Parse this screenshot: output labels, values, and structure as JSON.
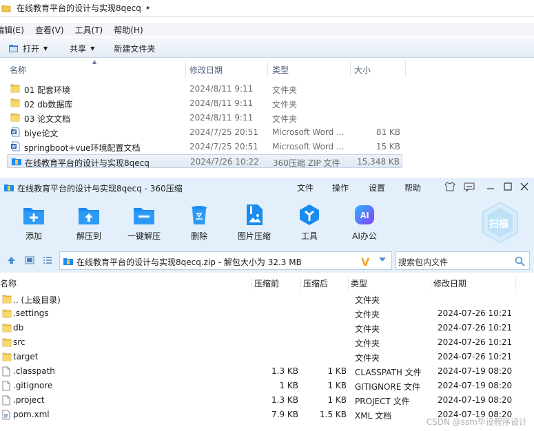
{
  "explorer": {
    "address": {
      "path": "在线教育平台的设计与实现8qecq",
      "arrow": "▸"
    },
    "menu": [
      "编辑(E)",
      "查看(V)",
      "工具(T)",
      "帮助(H)"
    ],
    "toolbar": {
      "open": "打开",
      "share": "共享",
      "new_folder": "新建文件夹"
    },
    "columns": {
      "name": "名称",
      "date": "修改日期",
      "type": "类型",
      "size": "大小"
    },
    "files": [
      {
        "icon": "folder-icon",
        "name": "01 配套环境",
        "date": "2024/8/11 9:11",
        "type": "文件夹",
        "size": ""
      },
      {
        "icon": "folder-icon",
        "name": "02 db数据库",
        "date": "2024/8/11 9:11",
        "type": "文件夹",
        "size": ""
      },
      {
        "icon": "folder-icon",
        "name": "03 论文文档",
        "date": "2024/8/11 9:11",
        "type": "文件夹",
        "size": ""
      },
      {
        "icon": "word-icon",
        "name": "biye论文",
        "date": "2024/7/25 20:51",
        "type": "Microsoft Word ...",
        "size": "81 KB"
      },
      {
        "icon": "word-icon",
        "name": "springboot+vue环境配置文档",
        "date": "2024/7/25 20:51",
        "type": "Microsoft Word ...",
        "size": "15 KB"
      },
      {
        "icon": "zip-icon",
        "name": "在线教育平台的设计与实现8qecq",
        "date": "2024/7/26 10:22",
        "type": "360压缩 ZIP 文件",
        "size": "15,348 KB",
        "selected": true
      }
    ]
  },
  "zip": {
    "title": "在线教育平台的设计与实现8qecq - 360压缩",
    "title_menu": [
      "文件",
      "操作",
      "设置",
      "帮助"
    ],
    "ribbon": [
      {
        "icon": "add-icon",
        "label": "添加"
      },
      {
        "icon": "extract-to-icon",
        "label": "解压到"
      },
      {
        "icon": "one-click-extract-icon",
        "label": "一键解压"
      },
      {
        "icon": "delete-icon",
        "label": "删除"
      },
      {
        "icon": "image-compress-icon",
        "label": "图片压缩"
      },
      {
        "icon": "tools-icon",
        "label": "工具"
      },
      {
        "icon": "ai-office-icon",
        "label": "AI办公"
      }
    ],
    "scan_label": "扫描",
    "path_text": "在线教育平台的设计与实现8qecq.zip - 解包大小为 32.3 MB",
    "search_placeholder": "搜索包内文件",
    "columns": {
      "name": "名称",
      "before": "压缩前",
      "after": "压缩后",
      "type": "类型",
      "date": "修改日期"
    },
    "entries": [
      {
        "icon": "folder-icon",
        "name": ".. (上级目录)",
        "before": "",
        "after": "",
        "type": "文件夹",
        "date": ""
      },
      {
        "icon": "folder-icon",
        "name": ".settings",
        "before": "",
        "after": "",
        "type": "文件夹",
        "date": "2024-07-26 10:21"
      },
      {
        "icon": "folder-icon",
        "name": "db",
        "before": "",
        "after": "",
        "type": "文件夹",
        "date": "2024-07-26 10:21"
      },
      {
        "icon": "folder-icon",
        "name": "src",
        "before": "",
        "after": "",
        "type": "文件夹",
        "date": "2024-07-26 10:21"
      },
      {
        "icon": "folder-icon",
        "name": "target",
        "before": "",
        "after": "",
        "type": "文件夹",
        "date": "2024-07-26 10:21"
      },
      {
        "icon": "file-icon",
        "name": ".classpath",
        "before": "1.3 KB",
        "after": "1 KB",
        "type": "CLASSPATH 文件",
        "date": "2024-07-19 08:20"
      },
      {
        "icon": "file-icon",
        "name": ".gitignore",
        "before": "1 KB",
        "after": "1 KB",
        "type": "GITIGNORE 文件",
        "date": "2024-07-19 08:20"
      },
      {
        "icon": "file-icon",
        "name": ".project",
        "before": "1.3 KB",
        "after": "1 KB",
        "type": "PROJECT 文件",
        "date": "2024-07-19 08:20"
      },
      {
        "icon": "xml-file-icon",
        "name": "pom.xml",
        "before": "7.9 KB",
        "after": "1.5 KB",
        "type": "XML 文档",
        "date": "2024-07-19 08:20"
      }
    ]
  },
  "watermark": "CSDN @ssm毕设程序设计",
  "colors": {
    "ribbon_bg": "#e3f0fb",
    "accent_blue": "#1a8cf0",
    "folder": "#f2c84b",
    "ai_purple": "#7b4ff5"
  }
}
